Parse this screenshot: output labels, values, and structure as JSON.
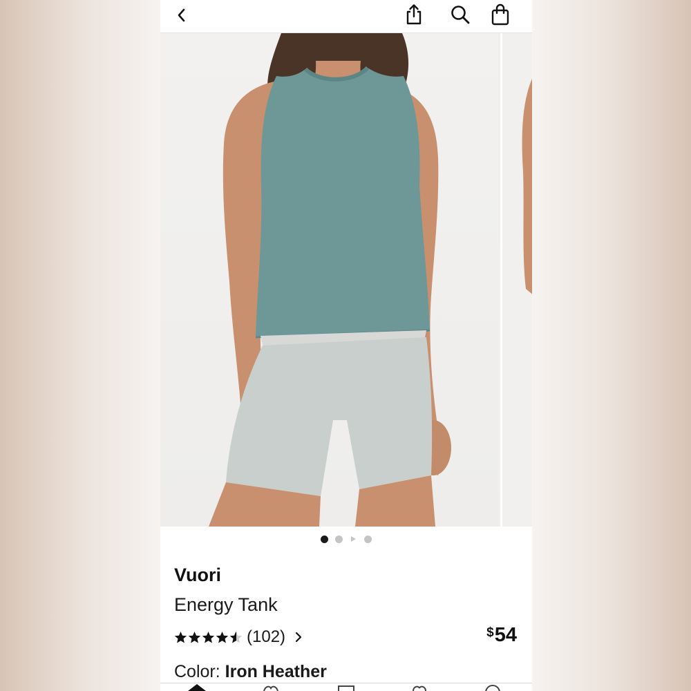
{
  "header": {
    "back_icon": "chevron-left-icon",
    "share_icon": "share-icon",
    "search_icon": "search-icon",
    "bag_icon": "shopping-bag-icon"
  },
  "gallery": {
    "image_count": 3,
    "active_index": 0,
    "has_video": true
  },
  "product": {
    "brand": "Vuori",
    "name": "Energy Tank",
    "rating": 4.5,
    "review_count": "(102)",
    "price_currency": "$",
    "price_amount": "54",
    "color_label": "Color:",
    "color_value": "Iron Heather"
  },
  "colors": {
    "top_teal": "#6e9898",
    "shorts_grey": "#c9cfcd",
    "text": "#111111"
  }
}
